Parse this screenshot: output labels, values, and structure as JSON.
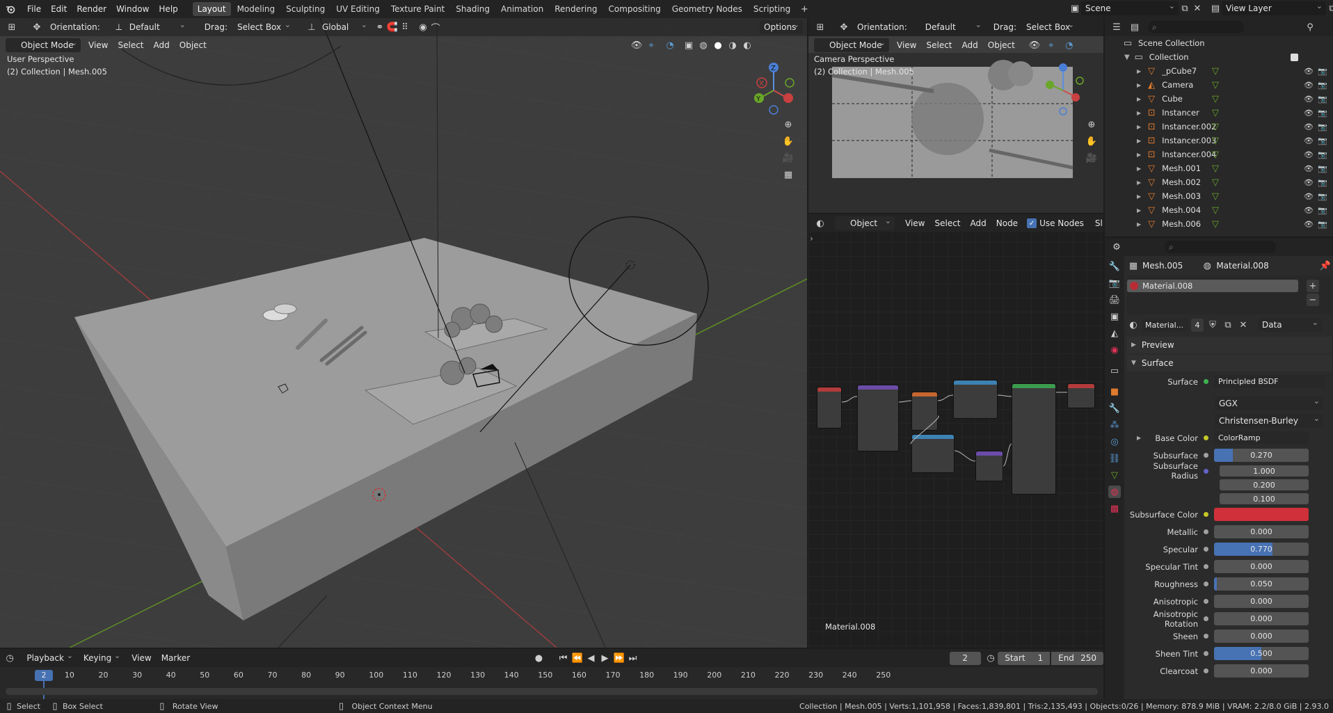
{
  "topbar": {
    "menus": [
      "File",
      "Edit",
      "Render",
      "Window",
      "Help"
    ],
    "workspaces": [
      "Layout",
      "Modeling",
      "Sculpting",
      "UV Editing",
      "Texture Paint",
      "Shading",
      "Animation",
      "Rendering",
      "Compositing",
      "Geometry Nodes",
      "Scripting"
    ],
    "active_workspace": "Layout",
    "add_tab": "+",
    "scene": "Scene",
    "view_layer": "View Layer"
  },
  "viewport": {
    "orientation_label": "Orientation:",
    "orientation_value": "Default",
    "drag_label": "Drag:",
    "drag_value": "Select Box",
    "transform": "Global",
    "options": "Options",
    "mode": "Object Mode",
    "menus": [
      "View",
      "Select",
      "Add",
      "Object"
    ],
    "perspective": "User Perspective",
    "collection_info": "(2) Collection | Mesh.005"
  },
  "camera_view": {
    "orientation_label": "Orientation:",
    "orientation_value": "Default",
    "drag_label": "Drag:",
    "drag_value": "Select Box",
    "mode": "Object Mode",
    "menus": [
      "View",
      "Select",
      "Add",
      "Object"
    ],
    "perspective": "Camera Perspective",
    "collection_info": "(2) Collection | Mesh.005"
  },
  "node_editor": {
    "type": "Object",
    "menus": [
      "View",
      "Select",
      "Add",
      "Node"
    ],
    "use_nodes": "Use Nodes",
    "slot_cut": "Sl",
    "material_name": "Material.008"
  },
  "outliner": {
    "root": "Scene Collection",
    "collection": "Collection",
    "items": [
      "_pCube7",
      "Camera",
      "Cube",
      "Instancer",
      "Instancer.002",
      "Instancer.003",
      "Instancer.004",
      "Mesh.001",
      "Mesh.002",
      "Mesh.003",
      "Mesh.004",
      "Mesh.006"
    ]
  },
  "properties": {
    "breadcrumb_object": "Mesh.005",
    "breadcrumb_material": "Material.008",
    "slot": "Material.008",
    "material_field": "Material...",
    "users": "4",
    "link": "Data",
    "panel_preview": "Preview",
    "panel_surface": "Surface",
    "surface_label": "Surface",
    "surface_value": "Principled BSDF",
    "distribution": "GGX",
    "subsurface_method": "Christensen-Burley",
    "rows": [
      {
        "label": "Base Color",
        "value": "ColorRamp",
        "kind": "link",
        "dot": "#c7c728"
      },
      {
        "label": "Subsurface",
        "value": "0.270",
        "kind": "slider",
        "fill": 0.2,
        "dot": "#a1a1a1"
      },
      {
        "label": "Subsurface Radius",
        "value": "1.000",
        "kind": "vector",
        "dot": "#6363c7"
      },
      {
        "label": "",
        "value": "0.200",
        "kind": "vector"
      },
      {
        "label": "",
        "value": "0.100",
        "kind": "vector"
      },
      {
        "label": "Subsurface Color",
        "value": "",
        "kind": "color",
        "color": "#d0303a",
        "dot": "#c7c728"
      },
      {
        "label": "Metallic",
        "value": "0.000",
        "kind": "slider",
        "fill": 0,
        "dot": "#a1a1a1"
      },
      {
        "label": "Specular",
        "value": "0.770",
        "kind": "slider",
        "fill": 0.62,
        "dot": "#a1a1a1"
      },
      {
        "label": "Specular Tint",
        "value": "0.000",
        "kind": "slider",
        "fill": 0,
        "dot": "#a1a1a1"
      },
      {
        "label": "Roughness",
        "value": "0.050",
        "kind": "slider",
        "fill": 0.03,
        "dot": "#a1a1a1"
      },
      {
        "label": "Anisotropic",
        "value": "0.000",
        "kind": "slider",
        "fill": 0,
        "dot": "#a1a1a1"
      },
      {
        "label": "Anisotropic Rotation",
        "value": "0.000",
        "kind": "slider",
        "fill": 0,
        "dot": "#a1a1a1"
      },
      {
        "label": "Sheen",
        "value": "0.000",
        "kind": "slider",
        "fill": 0,
        "dot": "#a1a1a1"
      },
      {
        "label": "Sheen Tint",
        "value": "0.500",
        "kind": "slider",
        "fill": 0.5,
        "dot": "#a1a1a1"
      },
      {
        "label": "Clearcoat",
        "value": "0.000",
        "kind": "slider",
        "fill": 0,
        "dot": "#a1a1a1"
      }
    ]
  },
  "timeline": {
    "menus": [
      "Playback",
      "Keying",
      "View",
      "Marker"
    ],
    "current_frame": "2",
    "start_label": "Start",
    "start": "1",
    "end_label": "End",
    "end": "250",
    "ticks": [
      "10",
      "20",
      "30",
      "40",
      "50",
      "60",
      "70",
      "80",
      "90",
      "100",
      "110",
      "120",
      "130",
      "140",
      "150",
      "160",
      "170",
      "180",
      "190",
      "200",
      "210",
      "220",
      "230",
      "240",
      "250"
    ]
  },
  "statusbar": {
    "select": "Select",
    "box_select": "Box Select",
    "rotate_view": "Rotate View",
    "context_menu": "Object Context Menu",
    "stats": "Collection | Mesh.005 | Verts:1,101,958 | Faces:1,839,801 | Tris:2,135,493 | Objects:0/26 | Memory: 878.9 MiB | VRAM: 2.2/8.0 GiB | 2.93.0"
  }
}
